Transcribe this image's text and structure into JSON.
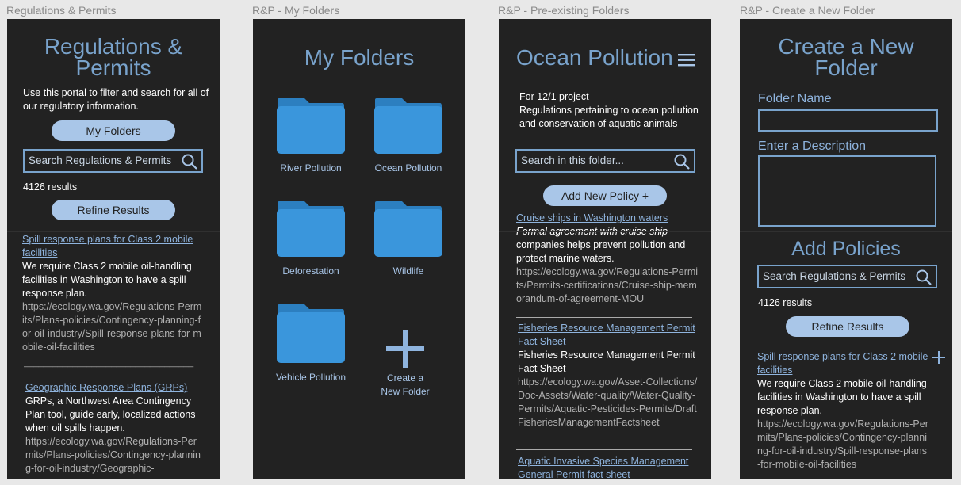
{
  "frames": [
    {
      "label": "Regulations & Permits",
      "title": "Regulations & Permits",
      "intro": "Use this portal to filter and search for all of our regulatory information.",
      "my_folders": "My Folders",
      "search_placeholder": "Search Regulations & Permits",
      "results": "4126 results",
      "refine": "Refine Results",
      "items": [
        {
          "link": "Spill response plans for Class 2 mobile facilities",
          "desc": "We require Class 2 mobile oil-handling facilities in Washington to have a spill response plan.",
          "url": "https://ecology.wa.gov/Regulations-Permits/Plans-policies/Contingency-planning-for-oil-industry/Spill-response-plans-for-mobile-oil-facilities"
        },
        {
          "link": "Geographic Response Plans (GRPs)",
          "desc": "GRPs, a Northwest Area Contingency Plan tool, guide early, localized actions when oil spills happen.",
          "url": "https://ecology.wa.gov/Regulations-Permits/Plans-policies/Contingency-planning-for-oil-industry/Geographic-"
        }
      ],
      "divider_text": "___________________________________"
    },
    {
      "label": "R&P - My Folders",
      "title": "My Folders",
      "folders": [
        "River Pollution",
        "Ocean Pollution",
        "Deforestation",
        "Wildlife",
        "Vehicle Pollution"
      ],
      "create_line1": "Create a",
      "create_line2": "New Folder"
    },
    {
      "label": "R&P - Pre-existing Folders",
      "title": "Ocean Pollution",
      "desc_line1": "For 12/1 project",
      "desc_line2": "Regulations pertaining to ocean pollution and conservation of aquatic animals",
      "search_placeholder": "Search in this folder...",
      "add_policy": "Add New Policy +",
      "items": [
        {
          "link": "Cruise ships in Washington waters",
          "desc_italic": "Formal agreement with cruise ship",
          "desc": "companies helps prevent pollution and protect marine waters.",
          "url": "https://ecology.wa.gov/Regulations-Permits/Permits-certifications/Cruise-ship-memorandum-of-agreement-MOU"
        },
        {
          "link": "Fisheries Resource Management Permit Fact Sheet",
          "desc": "Fisheries Resource Management Permit Fact Sheet",
          "url": "https://ecology.wa.gov/Asset-Collections/Doc-Assets/Water-quality/Water-Quality-Permits/Aquatic-Pesticides-Permits/DraftFisheriesManagementFactsheet"
        },
        {
          "link": "Aquatic Invasive Species Management General Permit fact sheet"
        }
      ]
    },
    {
      "label": "R&P - Create a New Folder",
      "title": "Create a New Folder",
      "folder_name": "Folder Name",
      "description": "Enter a Description",
      "add_policies": "Add Policies",
      "search_placeholder": "Search Regulations & Permits",
      "results": "4126 results",
      "refine": "Refine Results",
      "item": {
        "link": "Spill response plans for Class 2 mobile facilities",
        "desc": "We require Class 2 mobile oil-handling facilities in Washington to have a spill response plan.",
        "url": "https://ecology.wa.gov/Regulations-Permits/Plans-policies/Contingency-planning-for-oil-industry/Spill-response-plans-for-mobile-oil-facilities"
      }
    }
  ],
  "colors": {
    "background": "#e8e8e8",
    "frame": "#222222",
    "accent": "#79a3cc",
    "pill": "#a9c6e8",
    "folder": "#3a96dc"
  },
  "icons": [
    "search-icon",
    "folder-icon",
    "plus-icon",
    "hamburger-menu-icon"
  ]
}
